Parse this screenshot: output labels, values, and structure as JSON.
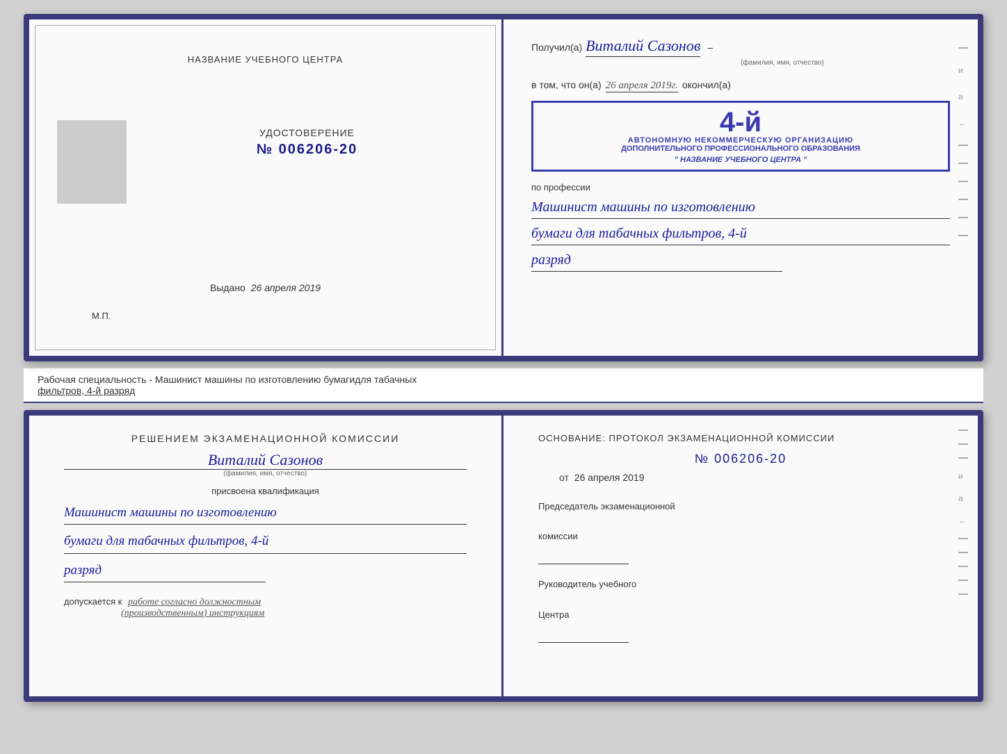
{
  "top_doc": {
    "left": {
      "title": "НАЗВАНИЕ УЧЕБНОГО ЦЕНТРА",
      "cert_label": "УДОСТОВЕРЕНИЕ",
      "cert_number": "№ 006206-20",
      "issued_prefix": "Выдано",
      "issued_date": "26 апреля 2019",
      "mp_label": "М.П."
    },
    "right": {
      "received_prefix": "Получил(а)",
      "name": "Виталий Сазонов",
      "name_sub": "(фамилия, имя, отчество)",
      "dash": "–",
      "vtom_prefix": "в том, что он(а)",
      "date_hw": "26 апреля 2019г.",
      "okonchil": "окончил(а)",
      "stamp_num": "4-й",
      "stamp_line1": "АВТОНОМНУЮ НЕКОММЕРЧЕСКУЮ ОРГАНИЗАЦИЮ",
      "stamp_line2": "ДОПОЛНИТЕЛЬНОГО ПРОФЕССИОНАЛЬНОГО ОБРАЗОВАНИЯ",
      "stamp_line3": "\" НАЗВАНИЕ УЧЕБНОГО ЦЕНТРА \"",
      "i_label": "и",
      "a_label": "а",
      "arrow_label": "←",
      "profession_prefix": "по профессии",
      "profession_hw1": "Машинист машины по изготовлению",
      "profession_hw2": "бумаги для табачных фильтров, 4-й",
      "profession_hw3": "разряд"
    }
  },
  "info_bar": {
    "text": "Рабочая специальность - Машинист машины по изготовлению бумагидля табачных",
    "text2": "фильтров, 4-й разряд"
  },
  "bottom_doc": {
    "left": {
      "decision_title": "Решением  экзаменационной  комиссии",
      "name_hw": "Виталий Сазонов",
      "name_sub": "(фамилия, имя, отчество)",
      "assigned_label": "присвоена квалификация",
      "prof_hw1": "Машинист машины по изготовлению",
      "prof_hw2": "бумаги для табачных фильтров, 4-й",
      "prof_hw3": "разряд",
      "admitted_prefix": "допускается к",
      "admitted_hw": "работе согласно должностным",
      "admitted_hw2": "(производственным) инструкциям"
    },
    "right": {
      "osnov_title": "Основание: протокол экзаменационной  комиссии",
      "protocol_num": "№  006206-20",
      "from_prefix": "от",
      "from_date": "26 апреля 2019",
      "chairman_label": "Председатель экзаменационной",
      "chairman_label2": "комиссии",
      "head_label": "Руководитель учебного",
      "head_label2": "Центра",
      "dash_labels": [
        "–",
        "–",
        "–",
        "и",
        "а",
        "←",
        "–",
        "–",
        "–",
        "–",
        "–"
      ]
    }
  }
}
